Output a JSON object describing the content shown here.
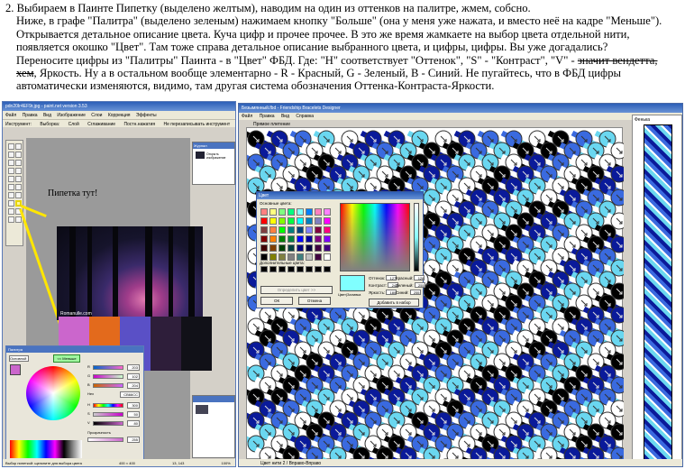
{
  "instructions": {
    "p1": "2. Выбираем в Паинте Пипетку (выделено желтым), наводим на один из оттенков на палитре, жмем, собсно.",
    "p2a": "Ниже, в графе \"Палитра\" (выделено зеленым) нажимаем кнопку \"Больше\" (она у меня уже нажата, и вместо неё на кадре \"Меньше\").",
    "p2b": "Открывается детальное описание цвета. Куча цифр и прочее прочее. В это же время жамкаете на выбор цвета отдельной нити,",
    "p2c": "появляется окошко \"Цвет\". Там тоже справа детальное описание выбранного цвета, и цифры, цифры. Вы уже догадались?",
    "p2d": "Переносите цифры из \"Палитры\" Паинта - в \"Цвет\" ФБД. Где: \"H\" соответствует \"Оттенок\", \"S\" - \"Контраст\", \"V\" -",
    "p2d_strike": "значит вендетта,",
    "p2e_strike": "хем",
    "p2e": ", Яркость. Ну а в остальном вообще элементарно - R - Красный, G - Зеленый, B - Синий. Не пугайтесь, что в ФБД цифры",
    "p2f": "автоматически изменяются, видимо, там другая система обозначения Оттенка-Контраста-Яркости."
  },
  "paint": {
    "title": "pdn20Ir4EF9r.jpg - paint.net version 3.53",
    "menu": [
      "Файл",
      "Правка",
      "Вид",
      "Изображение",
      "Слои",
      "Коррекция",
      "Эффекты"
    ],
    "toolbar1": [
      "Инструмент:",
      "Выборка:",
      "Слой",
      "Сглаживание",
      "Постн.нажатия",
      "Не перезаписывать инструмент"
    ],
    "pipette_label": "Пипетка тут!",
    "photo_caption": "Romanulle.com",
    "layers_title": "Журнал",
    "layers_item": "Открыть изображение",
    "palette_title": "Палитра",
    "primary_select": "Основной",
    "more_button": "<< Меньше",
    "slider_labels": [
      "R",
      "G",
      "B",
      "Hex",
      "H",
      "S",
      "V",
      "Прозрачность"
    ],
    "slider_values": [
      "203",
      "102",
      "204",
      "CB66CC",
      "300",
      "50",
      "80",
      "255"
    ],
    "status": [
      "Выбор пипеткой: щелкните для выбора цвета",
      "400 × 400",
      "13, 143",
      "100%"
    ]
  },
  "swatch_colors": [
    "#cb66cc",
    "#e36a1c",
    "#5a50c6",
    "#2e1e3a",
    "#111118"
  ],
  "designer": {
    "title": "Безымянный.fbd - Friendship Bracelets Designer",
    "menu": [
      "Файл",
      "Правка",
      "Вид",
      "Справка"
    ],
    "mode_label": "Прямое плетение",
    "preview_label": "Фенька",
    "status": "Цвет нити 2 / Вправо-Вправо"
  },
  "color_dialog": {
    "title": "Цвет",
    "basic_colors_label": "Основные цвета:",
    "custom_colors_label": "Дополнительные цвета:",
    "define_button": "Определить цвет >>",
    "ok_button": "ОК",
    "cancel_button": "Отмена",
    "swatch_label": "Цвет|Заливка",
    "add_button": "Добавить в набор",
    "hue_label": "Оттенок:",
    "hue_value": "127",
    "sat_label": "Контраст:",
    "sat_value": "240",
    "lum_label": "Яркость:",
    "lum_value": "180",
    "red_label": "Красный:",
    "red_value": "128",
    "green_label": "Зеленый:",
    "green_value": "255",
    "blue_label": "Синий:",
    "blue_value": "255",
    "basic_colors": [
      "#ff8080",
      "#ffff80",
      "#80ff80",
      "#00ff80",
      "#80ffff",
      "#0080ff",
      "#ff80c0",
      "#ff80ff",
      "#ff0000",
      "#ffff00",
      "#80ff00",
      "#00ff40",
      "#00ffff",
      "#0080c0",
      "#8080c0",
      "#ff00ff",
      "#804040",
      "#ff8040",
      "#00ff00",
      "#008080",
      "#004080",
      "#8080ff",
      "#800040",
      "#ff0080",
      "#800000",
      "#ff8000",
      "#008000",
      "#008040",
      "#0000ff",
      "#0000a0",
      "#800080",
      "#8000ff",
      "#400000",
      "#804000",
      "#004000",
      "#004040",
      "#000080",
      "#000040",
      "#400040",
      "#400080",
      "#000000",
      "#808000",
      "#808040",
      "#808080",
      "#408080",
      "#c0c0c0",
      "#400040",
      "#ffffff"
    ]
  },
  "pattern": {
    "thread_colors": [
      "#000000",
      "#0a1a9a",
      "#3a6adf",
      "#6ad7f0",
      "#ffffff"
    ]
  }
}
